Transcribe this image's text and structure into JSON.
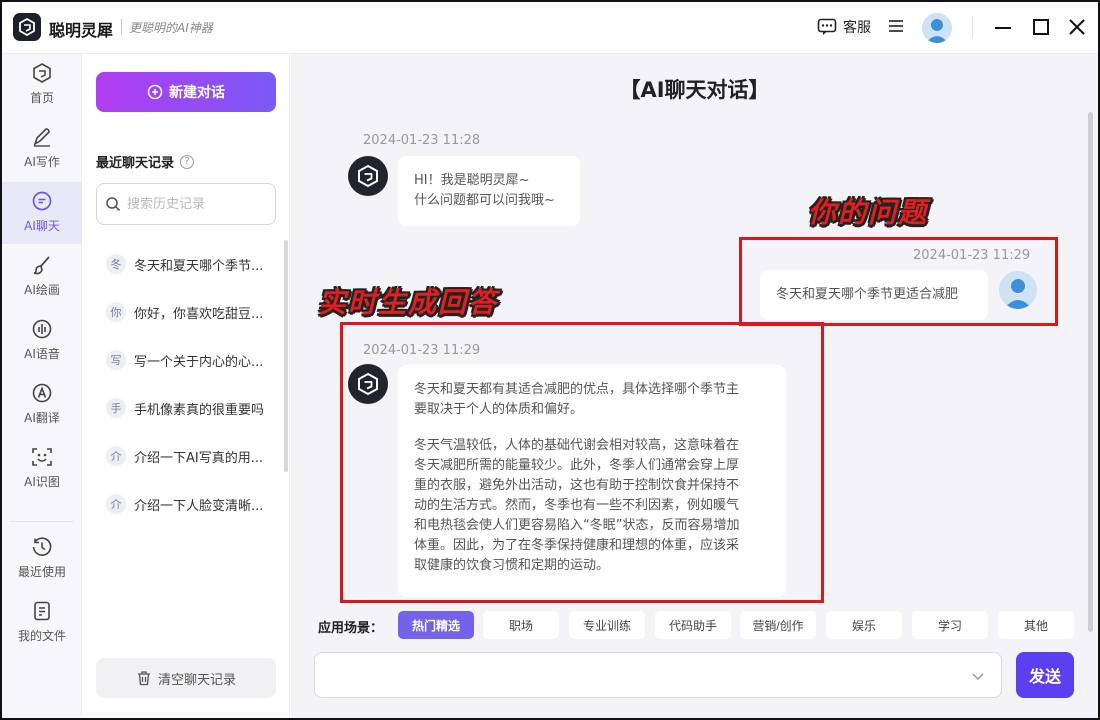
{
  "app": {
    "name": "聪明灵犀",
    "slogan": "更聪明的AI神器"
  },
  "titlebar": {
    "customer_service": "客服"
  },
  "nav": {
    "items": [
      {
        "label": "首页",
        "icon": "home-icon"
      },
      {
        "label": "AI写作",
        "icon": "pen-icon"
      },
      {
        "label": "AI聊天",
        "icon": "chat-icon",
        "active": true
      },
      {
        "label": "AI绘画",
        "icon": "brush-icon"
      },
      {
        "label": "AI语音",
        "icon": "voice-icon"
      },
      {
        "label": "AI翻译",
        "icon": "translate-icon"
      },
      {
        "label": "AI识图",
        "icon": "image-recognition-icon"
      }
    ],
    "bottom_items": [
      {
        "label": "最近使用",
        "icon": "clock-icon"
      },
      {
        "label": "我的文件",
        "icon": "file-icon"
      }
    ]
  },
  "history": {
    "new_chat_label": "新建对话",
    "title": "最近聊天记录",
    "search_placeholder": "搜索历史记录",
    "items": [
      {
        "badge": "冬",
        "text": "冬天和夏天哪个季节..."
      },
      {
        "badge": "你",
        "text": "你好，你喜欢吃甜豆..."
      },
      {
        "badge": "写",
        "text": "写一个关于内心的心..."
      },
      {
        "badge": "手",
        "text": "手机像素真的很重要吗"
      },
      {
        "badge": "介",
        "text": "介绍一下AI写真的用..."
      },
      {
        "badge": "介",
        "text": "介绍一下人脸变清晰..."
      }
    ],
    "clear_label": "清空聊天记录"
  },
  "chat": {
    "title": "【AI聊天对话】",
    "messages": [
      {
        "role": "bot",
        "time": "2024-01-23 11:28",
        "lines": [
          "HI！我是聪明灵犀~",
          "什么问题都可以问我哦~"
        ]
      },
      {
        "role": "user",
        "time": "2024-01-23 11:29",
        "text": "冬天和夏天哪个季节更适合减肥"
      },
      {
        "role": "bot",
        "time": "2024-01-23 11:29",
        "paragraphs": [
          [
            "冬天和夏天都有其适合减肥的优点，具体选择哪个季节主",
            "要取决于个人的体质和偏好。"
          ],
          [
            "冬天气温较低，人体的基础代谢会相对较高，这意味着在",
            "冬天减肥所需的能量较少。此外，冬季人们通常会穿上厚",
            "重的衣服，避免外出活动，这也有助于控制饮食并保持不",
            "动的生活方式。然而，冬季也有一些不利因素，例如暖气",
            "和电热毯会使人们更容易陷入“冬眠”状态，反而容易增加",
            "体重。因此，为了在冬季保持健康和理想的体重，应该采",
            "取健康的饮食习惯和定期的运动。"
          ]
        ]
      }
    ],
    "annotations": {
      "question": "你的问题",
      "answer": "实时生成回答"
    },
    "scene_label": "应用场景：",
    "scenes": [
      "热门精选",
      "职场",
      "专业训练",
      "代码助手",
      "营销/创作",
      "娱乐",
      "学习",
      "其他"
    ],
    "input_value": "",
    "send_label": "发送"
  },
  "colors": {
    "accent": "#5b3ff0",
    "new_chat_start": "#b13cf0",
    "new_chat_end": "#7b5af5",
    "annotation": "#e02020"
  }
}
